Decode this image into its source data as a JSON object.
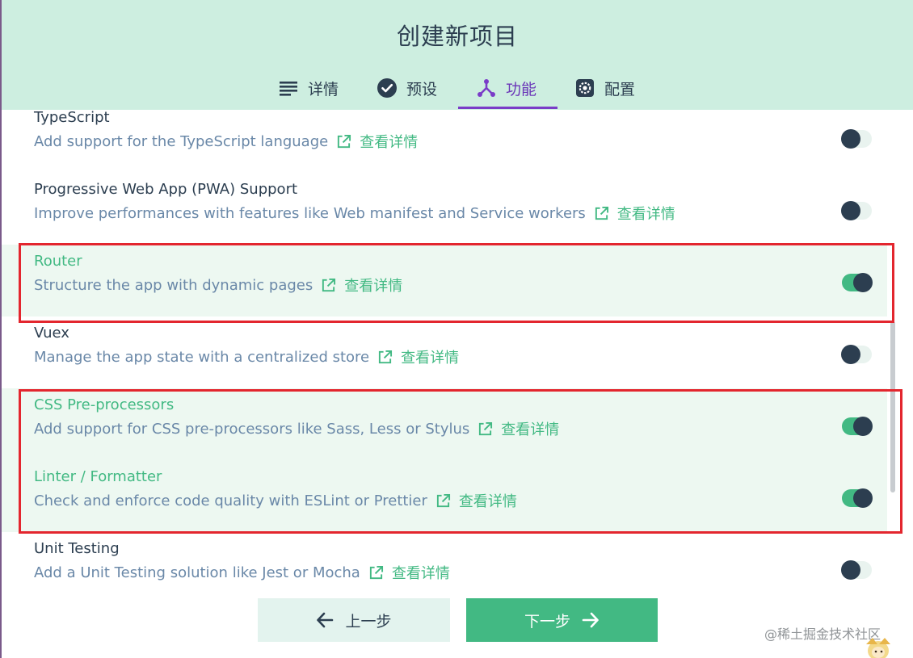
{
  "header": {
    "title": "创建新项目",
    "tabs": [
      {
        "label": "详情",
        "icon": "list-icon",
        "active": false
      },
      {
        "label": "预设",
        "icon": "check-circle-icon",
        "active": false
      },
      {
        "label": "功能",
        "icon": "fork-icon",
        "active": true
      },
      {
        "label": "配置",
        "icon": "gear-icon",
        "active": false
      }
    ]
  },
  "features": [
    {
      "title": "TypeScript",
      "desc": "Add support for the TypeScript language",
      "link": "查看详情",
      "enabled": false
    },
    {
      "title": "Progressive Web App (PWA) Support",
      "desc": "Improve performances with features like Web manifest and Service workers",
      "link": "查看详情",
      "enabled": false
    },
    {
      "title": "Router",
      "desc": "Structure the app with dynamic pages",
      "link": "查看详情",
      "enabled": true
    },
    {
      "title": "Vuex",
      "desc": "Manage the app state with a centralized store",
      "link": "查看详情",
      "enabled": false
    },
    {
      "title": "CSS Pre-processors",
      "desc": "Add support for CSS pre-processors like Sass, Less or Stylus",
      "link": "查看详情",
      "enabled": true
    },
    {
      "title": "Linter / Formatter",
      "desc": "Check and enforce code quality with ESLint or Prettier",
      "link": "查看详情",
      "enabled": true
    },
    {
      "title": "Unit Testing",
      "desc": "Add a Unit Testing solution like Jest or Mocha",
      "link": "查看详情",
      "enabled": false
    }
  ],
  "footer": {
    "prev_label": "上一步",
    "next_label": "下一步"
  },
  "watermark": "@稀土掘金技术社区",
  "colors": {
    "accent": "#42b983",
    "header_bg": "#cdeee0",
    "active_tab": "#7a3cc8",
    "highlight_border": "#e3262e",
    "text_dark": "#2c3e50",
    "text_muted": "#6a88a8"
  }
}
